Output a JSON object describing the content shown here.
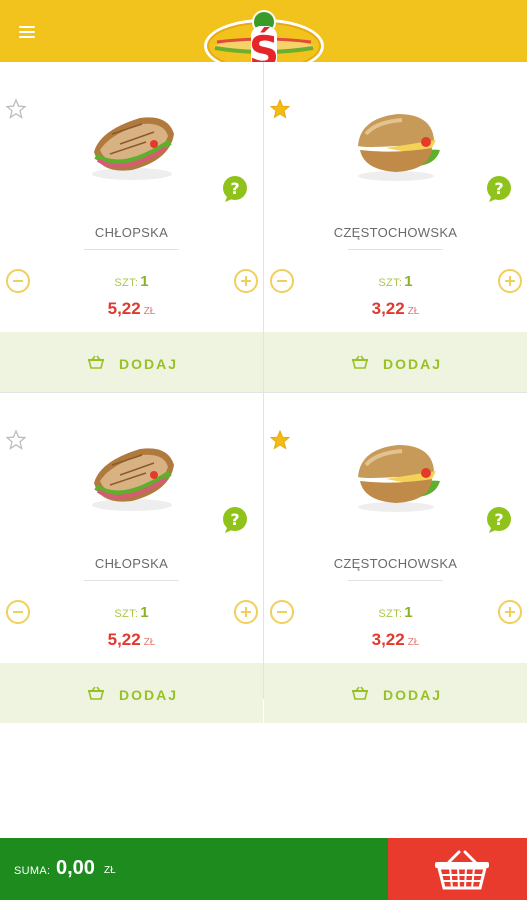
{
  "header": {
    "menu_icon": "menu-icon",
    "logo_letter": "Ś"
  },
  "products": [
    {
      "name": "CHŁOPSKA",
      "favorite": false,
      "qty_label": "SZT:",
      "qty": "1",
      "price": "5,22",
      "currency": "ZŁ",
      "add_label": "DODAJ"
    },
    {
      "name": "CZĘSTOCHOWSKA",
      "favorite": true,
      "qty_label": "SZT:",
      "qty": "1",
      "price": "3,22",
      "currency": "ZŁ",
      "add_label": "DODAJ"
    },
    {
      "name": "CHŁOPSKA",
      "favorite": false,
      "qty_label": "SZT:",
      "qty": "1",
      "price": "5,22",
      "currency": "ZŁ",
      "add_label": "DODAJ"
    },
    {
      "name": "CZĘSTOCHOWSKA",
      "favorite": true,
      "qty_label": "SZT:",
      "qty": "1",
      "price": "3,22",
      "currency": "ZŁ",
      "add_label": "DODAJ"
    }
  ],
  "footer": {
    "sum_label": "SUMA:",
    "sum_value": "0,00",
    "currency": "ZŁ",
    "cart_icon": "basket-icon"
  },
  "colors": {
    "header": "#f2c31c",
    "accent_green": "#98c126",
    "price_red": "#e03a2f",
    "footer_green": "#1e8b1f",
    "cart_red": "#e93a2e"
  }
}
